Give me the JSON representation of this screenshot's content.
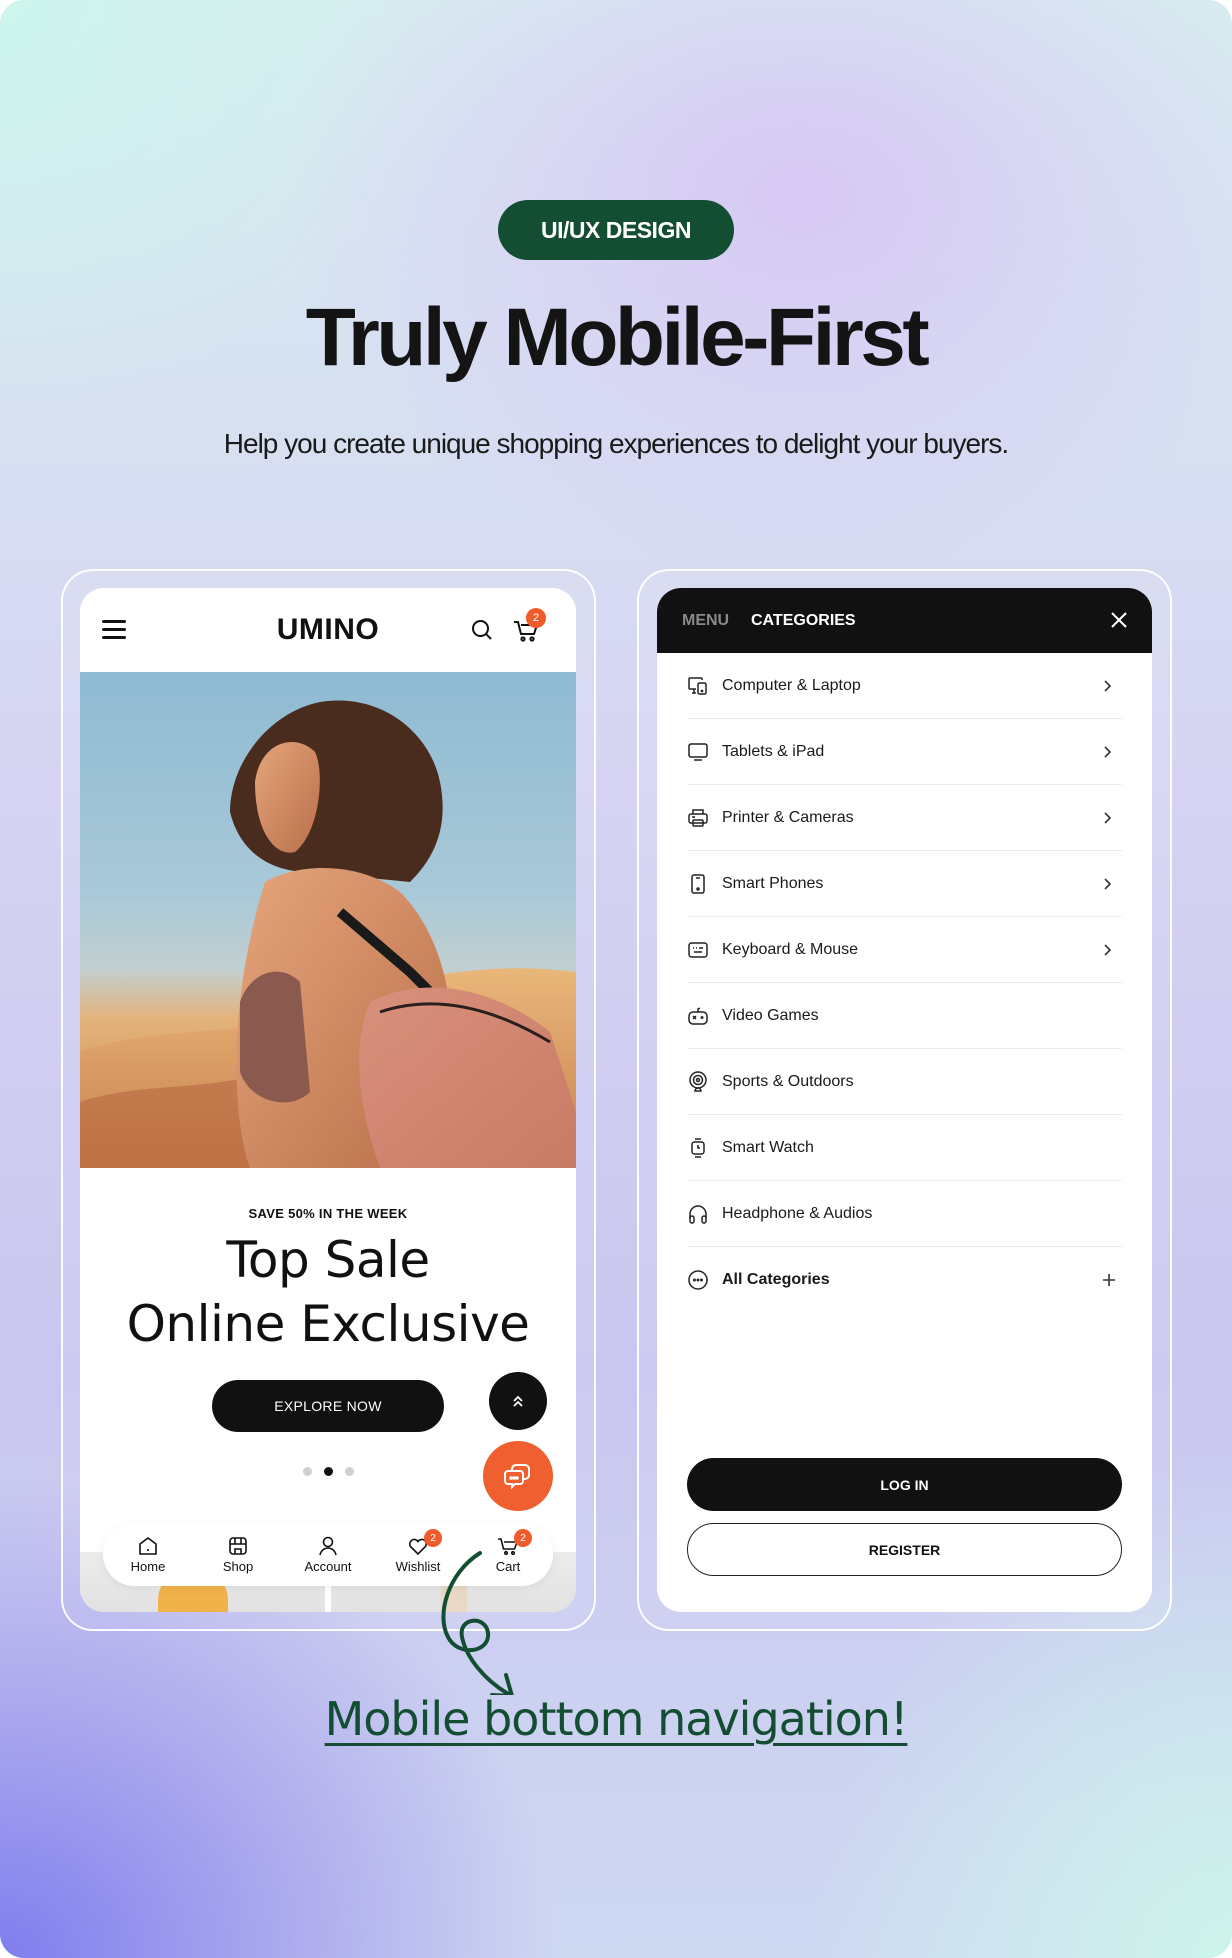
{
  "hero": {
    "tag": "UI/UX DESIGN",
    "title": "Truly Mobile-First",
    "subtitle": "Help you create unique shopping experiences to delight your buyers."
  },
  "colors": {
    "brand_green": "#134d32",
    "accent_orange": "#ef5b2b",
    "dark": "#111111"
  },
  "left_phone": {
    "logo": "UMINO",
    "cart_count": "2",
    "promo": {
      "eyebrow": "SAVE 50% IN THE WEEK",
      "title_line1": "Top Sale",
      "title_line2": "Online Exclusive",
      "cta": "EXPLORE NOW"
    },
    "carousel": {
      "total": 3,
      "active_index": 1
    },
    "bottom_nav": [
      {
        "label": "Home",
        "icon": "home-icon"
      },
      {
        "label": "Shop",
        "icon": "shop-icon"
      },
      {
        "label": "Account",
        "icon": "account-icon"
      },
      {
        "label": "Wishlist",
        "icon": "heart-icon",
        "badge": "2"
      },
      {
        "label": "Cart",
        "icon": "cart-icon",
        "badge": "2"
      }
    ]
  },
  "right_phone": {
    "tabs": {
      "menu": "MENU",
      "categories": "CATEGORIES"
    },
    "categories": [
      {
        "label": "Computer & Laptop",
        "icon": "computer-icon",
        "has_children": true
      },
      {
        "label": "Tablets & iPad",
        "icon": "tablet-icon",
        "has_children": true
      },
      {
        "label": "Printer & Cameras",
        "icon": "printer-icon",
        "has_children": true
      },
      {
        "label": "Smart Phones",
        "icon": "phone-icon",
        "has_children": true
      },
      {
        "label": "Keyboard & Mouse",
        "icon": "keyboard-icon",
        "has_children": true
      },
      {
        "label": "Video Games",
        "icon": "gamepad-icon",
        "has_children": false
      },
      {
        "label": "Sports & Outdoors",
        "icon": "sports-icon",
        "has_children": false
      },
      {
        "label": "Smart Watch",
        "icon": "watch-icon",
        "has_children": false
      },
      {
        "label": "Headphone & Audios",
        "icon": "headphone-icon",
        "has_children": false
      },
      {
        "label": "All Categories",
        "icon": "more-icon",
        "has_children": false,
        "expand": true
      }
    ],
    "login": "LOG IN",
    "register": "REGISTER"
  },
  "annotation": "Mobile bottom navigation!"
}
